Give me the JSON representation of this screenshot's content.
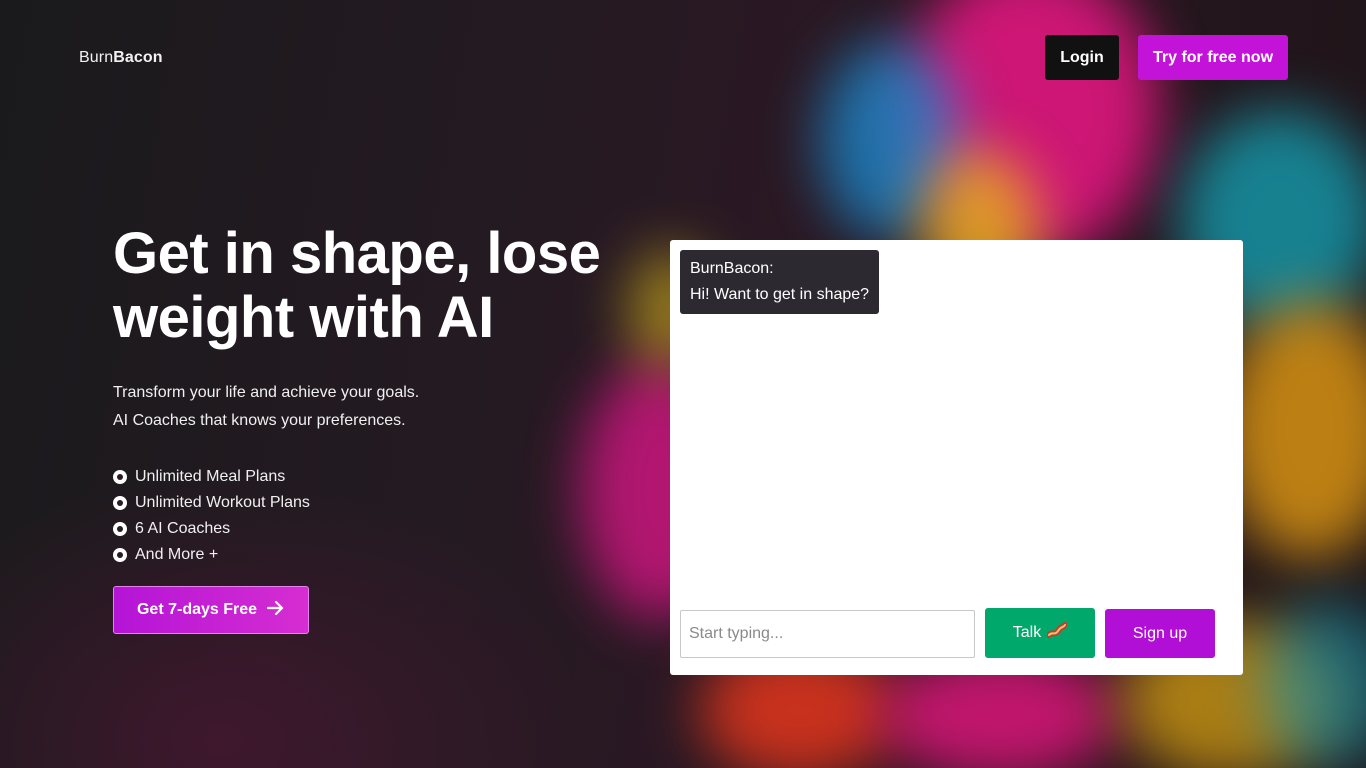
{
  "brand": {
    "prefix": "Burn",
    "suffix": "Bacon"
  },
  "nav": {
    "login_label": "Login",
    "try_label": "Try for free now"
  },
  "hero": {
    "title": "Get in shape, lose weight with AI",
    "subtitle_line1": "Transform your life and achieve your goals.",
    "subtitle_line2": "AI Coaches that knows your preferences.",
    "features": [
      "Unlimited Meal Plans",
      "Unlimited Workout Plans",
      "6 AI Coaches",
      "And More +"
    ],
    "cta_label": "Get 7-days Free",
    "cta_icon": "arrow-right-icon"
  },
  "chat": {
    "message_sender": "BurnBacon:",
    "message_text": "Hi! Want to get in shape?",
    "input_placeholder": "Start typing...",
    "input_value": "",
    "talk_label": "Talk",
    "talk_icon": "bacon-icon",
    "signup_label": "Sign up"
  },
  "colors": {
    "accent_purple": "#c413d8",
    "talk_green": "#00a96b",
    "background": "#1e1a1d"
  }
}
